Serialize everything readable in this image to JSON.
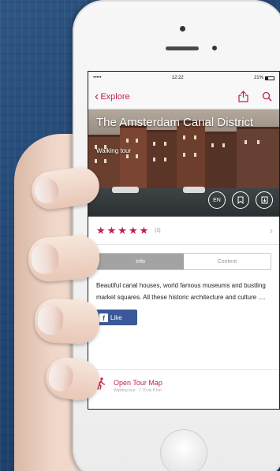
{
  "colors": {
    "accent": "#c21e56",
    "facebook": "#3b5998"
  },
  "status_bar": {
    "signal": "••••• ",
    "time": "12:22",
    "battery": "21%"
  },
  "nav": {
    "back_label": "Explore",
    "share_icon": "share-icon",
    "search_icon": "search-icon"
  },
  "hero": {
    "title": "The Amsterdam Canal District",
    "subtitle": "Walking tour",
    "language": "EN",
    "bookmark_icon": "bookmark-icon",
    "download_icon": "download-icon"
  },
  "rating": {
    "stars": "★★★★★",
    "stars_value": 5,
    "count": "(1)"
  },
  "tabs": [
    {
      "label": "Info",
      "active": true
    },
    {
      "label": "Content",
      "active": false
    }
  ],
  "description": "Beautiful canal houses, world famous museums and bustling market squares. All these historic architecture and culture ....",
  "like_button": {
    "label": "Like"
  },
  "tour_map": {
    "title": "Open Tour Map",
    "detail": "Walking tour · 7.70 mi 8 km"
  }
}
